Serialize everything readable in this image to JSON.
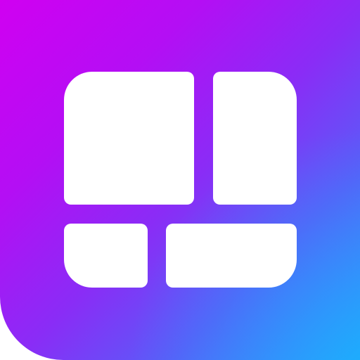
{
  "app_icon": {
    "icon_name": "collage-grid-icon",
    "colors": {
      "gradient_start": "#d000f2",
      "gradient_mid": "#8a2cf6",
      "gradient_end": "#2aa2fb",
      "tile": "#ffffff"
    },
    "tiles": [
      {
        "name": "large-left-tile"
      },
      {
        "name": "tall-right-tile"
      },
      {
        "name": "small-bottom-left-tile"
      },
      {
        "name": "wide-bottom-right-tile"
      }
    ]
  }
}
